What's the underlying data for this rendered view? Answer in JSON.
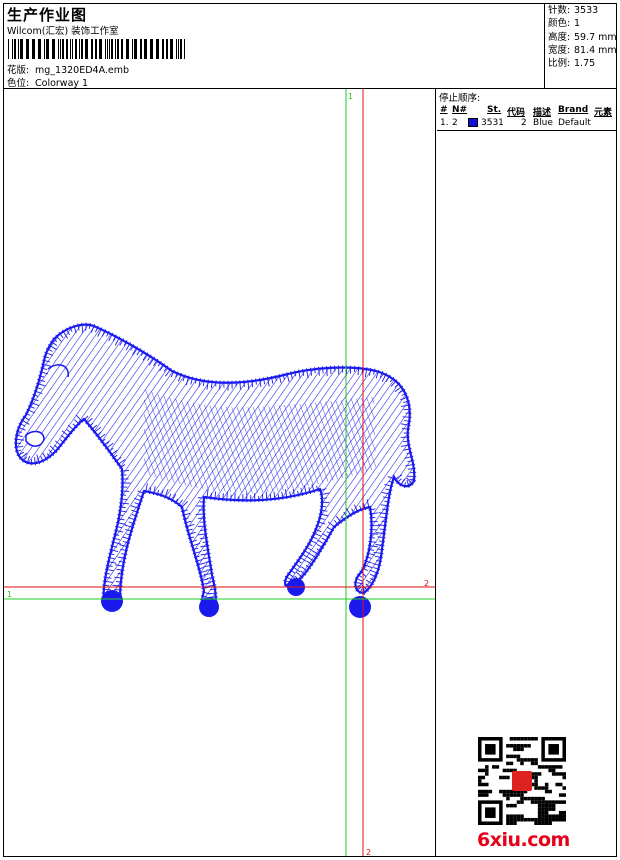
{
  "header": {
    "title": "生产作业图",
    "company": "Wilcom(汇宏) 装饰工作室",
    "design_label": "花版:",
    "design_value": "mg_1320ED4A.emb",
    "colorway_label": "色位:",
    "colorway_value": "Colorway 1"
  },
  "stats": [
    {
      "label": "针数:",
      "value": "3533"
    },
    {
      "label": "颜色:",
      "value": "1"
    },
    {
      "label": "高度:",
      "value": "59.7 mm"
    },
    {
      "label": "宽度:",
      "value": "81.4 mm"
    },
    {
      "label": "比例:",
      "value": "1.75"
    }
  ],
  "panel": {
    "title": "停止顺序:",
    "columns": [
      "#",
      "N#",
      "St.",
      "代码",
      "描述",
      "Brand",
      "元素"
    ],
    "rows": [
      {
        "index": "1.",
        "needle": "2",
        "stitches": "3531",
        "code": "2",
        "description": "Blue",
        "brand": "Default",
        "color": "#1010dd"
      }
    ]
  },
  "canvas": {
    "guide_labels": {
      "green_v": "1",
      "green_h": "1",
      "red_h": "2",
      "red_v": "2"
    },
    "guide_colors": {
      "green": "#22cc22",
      "red": "#dd1111"
    },
    "thread_color": "#1a1aee"
  },
  "watermark": "6xiu.com"
}
